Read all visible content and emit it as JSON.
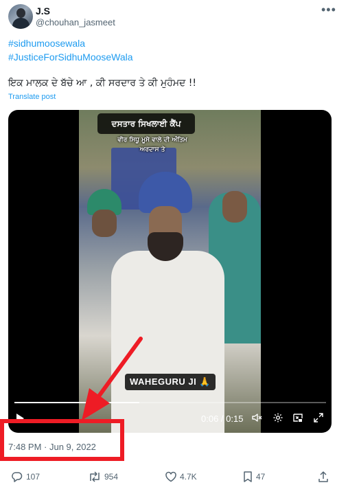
{
  "author": {
    "display_name": "J.S",
    "handle": "@chouhan_jasmeet",
    "avatar_icon": "user-avatar"
  },
  "menu": {
    "more_icon": "more-horizontal-icon",
    "more_label": "•••"
  },
  "tweet": {
    "hashtags": [
      "#sidhumoosewala",
      "#JusticeForSidhuMooseWala"
    ],
    "text": "ਇਕ ਮਾਲਕ ਦੇ ਬੱਚੇ ਆ , ਕੀ ਸਰਦਾਰ ਤੇ ਕੀ ਮੁਹੰਮਦ !!",
    "translate_label": "Translate post",
    "timestamp": "7:48 PM · Jun 9, 2022"
  },
  "video": {
    "caption_title": "ਦਸਤਾਰ ਸਿਖਲਾਈ ਕੈਂਪ",
    "caption_line1": "ਵੀਰ ਸਿਧੂ ਮੂਸੇ ਵਾਲੇ ਦੀ ਅੰਤਿਮ",
    "caption_line2": "ਅਰਦਾਸ ਤੇ",
    "overlay_text": "WAHEGURU JI 🙏",
    "current_time": "0:06",
    "duration": "0:15",
    "time_display": "0:06 / 0:15",
    "progress": 0.4
  },
  "annotation": {
    "highlight_color": "#ee1c25"
  },
  "actions": {
    "replies": "107",
    "reposts": "954",
    "likes": "4.7K",
    "bookmarks": "47"
  },
  "colors": {
    "link": "#1d9bf0",
    "secondary_text": "#536471",
    "primary_text": "#0f1419"
  }
}
